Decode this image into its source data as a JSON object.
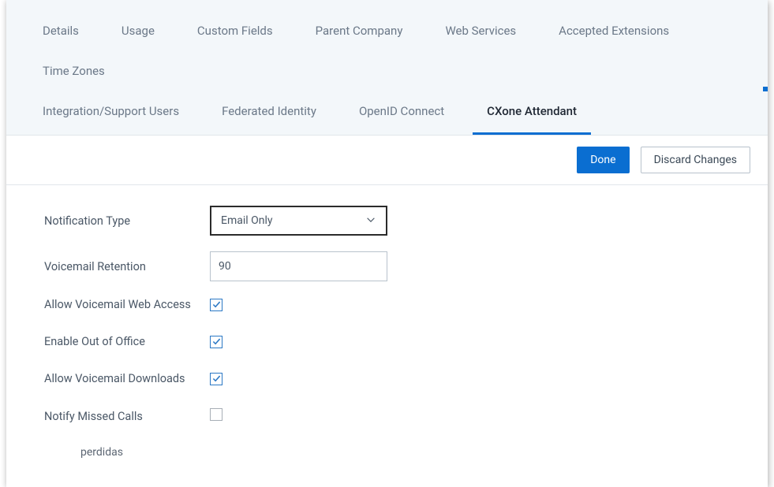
{
  "tabs": {
    "row1": [
      {
        "label": "Details",
        "active": false
      },
      {
        "label": "Usage",
        "active": false
      },
      {
        "label": "Custom Fields",
        "active": false
      },
      {
        "label": "Parent Company",
        "active": false
      },
      {
        "label": "Web Services",
        "active": false
      },
      {
        "label": "Accepted Extensions",
        "active": false
      },
      {
        "label": "Time Zones",
        "active": false
      }
    ],
    "row2": [
      {
        "label": "Integration/Support Users",
        "active": false
      },
      {
        "label": "Federated Identity",
        "active": false
      },
      {
        "label": "OpenID Connect",
        "active": false
      },
      {
        "label": "CXone Attendant",
        "active": true
      }
    ]
  },
  "actions": {
    "done_label": "Done",
    "discard_label": "Discard Changes"
  },
  "form": {
    "notification_type": {
      "label": "Notification Type",
      "value": "Email Only"
    },
    "vm_retention": {
      "label": "Voicemail Retention",
      "value": "90"
    },
    "allow_web": {
      "label": "Allow Voicemail Web Access",
      "checked": true
    },
    "ooo": {
      "label": "Enable Out of Office",
      "checked": true
    },
    "allow_dl": {
      "label": "Allow Voicemail Downloads",
      "checked": true
    },
    "notify_missed": {
      "label": "Notify Missed Calls",
      "checked": false
    }
  },
  "stray_text": "perdidas"
}
